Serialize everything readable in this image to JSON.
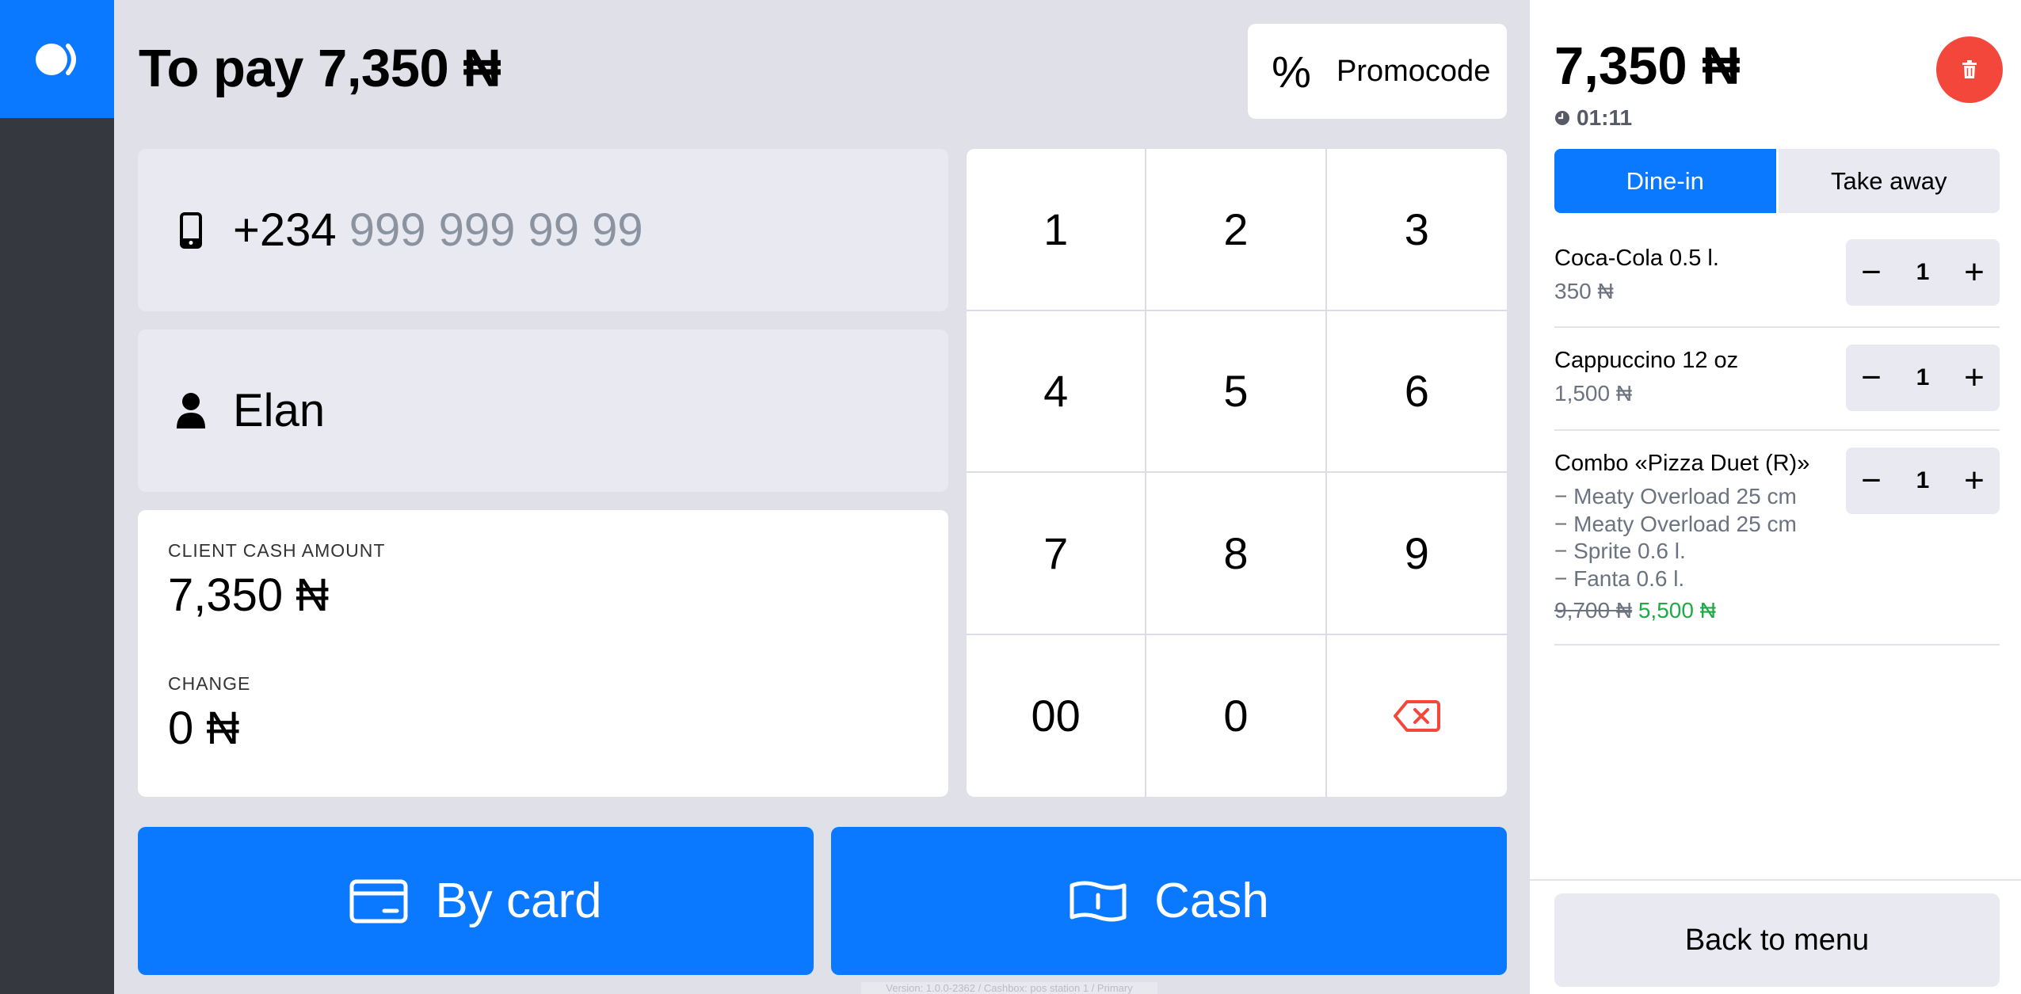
{
  "rail": {
    "logo_icon": "logo-toggle-icon",
    "accent": "#0a78ff"
  },
  "header": {
    "to_pay": "To pay 7,350 ₦",
    "promo_icon": "%",
    "promo_label": "Promocode"
  },
  "phone": {
    "prefix": "+234",
    "placeholder": "999 999 99 99",
    "icon": "phone-icon"
  },
  "customer": {
    "name": "Elan",
    "icon": "user-icon"
  },
  "amounts": {
    "client_cash_label": "CLIENT CASH AMOUNT",
    "client_cash_value": "7,350 ₦",
    "change_label": "CHANGE",
    "change_value": "0 ₦"
  },
  "keypad": {
    "keys": [
      "1",
      "2",
      "3",
      "4",
      "5",
      "6",
      "7",
      "8",
      "9",
      "00",
      "0"
    ],
    "backspace_icon": "backspace-icon"
  },
  "pay": {
    "card_label": "By card",
    "cash_label": "Cash"
  },
  "footer": {
    "version": "Version: 1.0.0-2362 / Cashbox: pos station 1 / Primary"
  },
  "order": {
    "total": "7,350 ₦",
    "elapsed": "01:11",
    "mode_options": [
      "Dine-in",
      "Take away"
    ],
    "selected_mode": "Dine-in",
    "items": [
      {
        "name": "Coca-Cola 0.5 l.",
        "price": "350 ₦",
        "qty": "1"
      },
      {
        "name": "Cappuccino 12 oz",
        "price": "1,500 ₦",
        "qty": "1"
      },
      {
        "name": "Combo «Pizza Duet (R)»",
        "components": [
          "− Meaty Overload 25 cm",
          "− Meaty Overload 25 cm",
          "− Sprite 0.6 l.",
          "− Fanta 0.6 l."
        ],
        "old_price": "9,700 ₦",
        "new_price": "5,500 ₦",
        "qty": "1"
      }
    ],
    "back_label": "Back to menu"
  },
  "colors": {
    "primary": "#0a78ff",
    "danger": "#f4473b",
    "discount": "#1eaa46",
    "rail": "#363840"
  }
}
